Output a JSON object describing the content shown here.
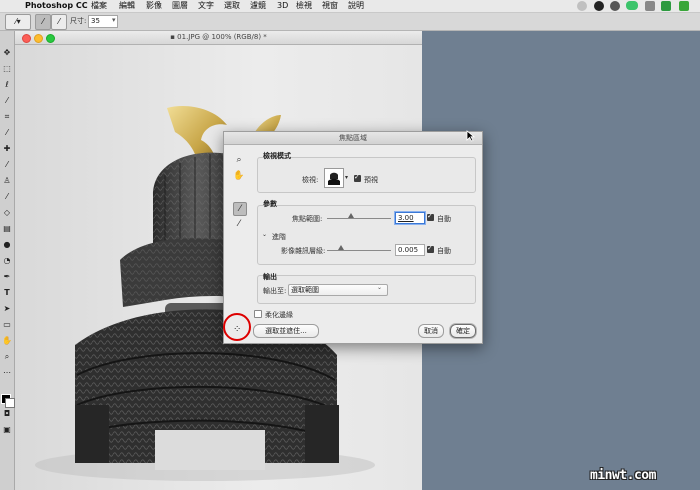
{
  "menubar": {
    "app_name": "Photoshop CC",
    "items": [
      "檔案",
      "編輯",
      "影像",
      "圖層",
      "文字",
      "選取",
      "濾鏡",
      "3D",
      "檢視",
      "視窗",
      "說明"
    ]
  },
  "options_bar": {
    "size_label": "尺寸:",
    "size_value": "35"
  },
  "document": {
    "title": "01.JPG @ 100% (RGB/8) *"
  },
  "dialog": {
    "title": "焦點區域",
    "view_mode": {
      "heading": "檢視模式",
      "view_label": "檢視:",
      "preview_label": "預視",
      "preview_checked": true
    },
    "parameters": {
      "heading": "參數",
      "focus_range_label": "焦點範圍:",
      "focus_range_value": "3.00",
      "focus_auto_label": "自動",
      "focus_auto_checked": true,
      "advanced_label": "進階",
      "noise_label": "影像雜訊層級:",
      "noise_value": "0.005",
      "noise_auto_label": "自動",
      "noise_auto_checked": true
    },
    "output": {
      "heading": "輸出",
      "output_to_label": "輸出至:",
      "output_to_value": "選取範圍"
    },
    "soften_edge_label": "柔化邊緣",
    "soften_edge_checked": false,
    "select_and_mask_button": "選取並遮住...",
    "cancel_button": "取消",
    "ok_button": "確定"
  },
  "watermark": "minwt.com",
  "colors": {
    "workspace": "#6f7f91",
    "highlight_circle": "#d00000",
    "focus_field_highlight": "#3a78d6"
  }
}
